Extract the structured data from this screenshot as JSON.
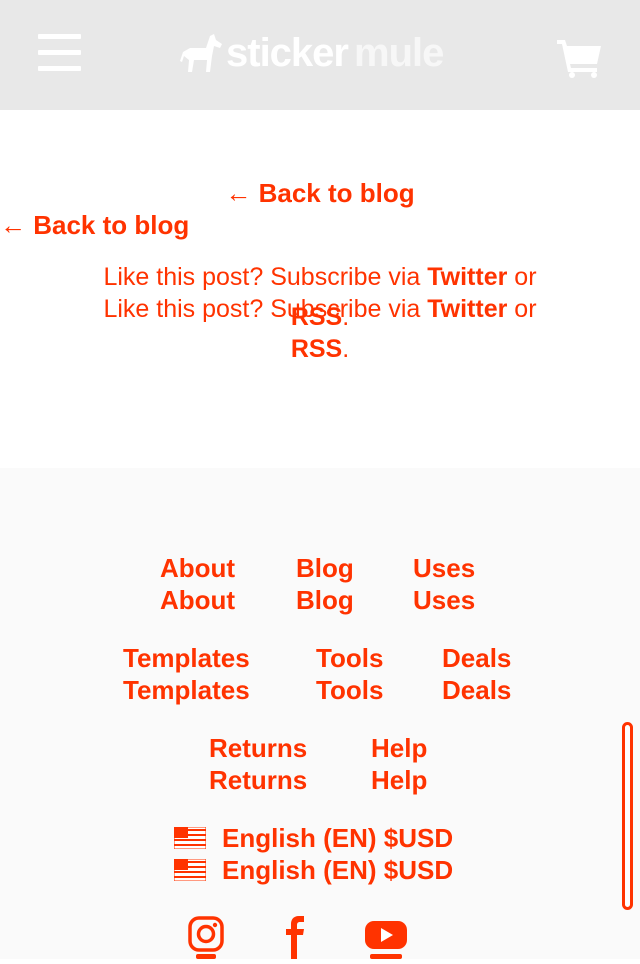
{
  "header": {
    "brand_part1": "sticker",
    "brand_part2": "mule",
    "icons": {
      "menu": "hamburger-menu-icon",
      "cart": "shopping-cart-icon",
      "logo": "mule-logo-icon"
    },
    "colors": {
      "header_bg": "#e8e8e8",
      "icon": "#ffffff"
    }
  },
  "article": {
    "back_link": "← Back to blog",
    "subscribe": {
      "prefix": "Like this post? Subscribe via ",
      "twitter": "Twitter",
      "or": " or",
      "rss": "RSS",
      "suffix": "."
    }
  },
  "footer": {
    "rows": [
      [
        "About",
        "Blog",
        "Uses"
      ],
      [
        "Templates",
        "Tools",
        "Deals"
      ],
      [
        "Returns",
        "Help"
      ]
    ],
    "language": "English (EN) $USD",
    "social_icons": [
      "instagram-icon",
      "facebook-icon",
      "youtube-icon"
    ],
    "colors": {
      "link": "#ff3300",
      "footer_bg": "#fafafa"
    }
  }
}
